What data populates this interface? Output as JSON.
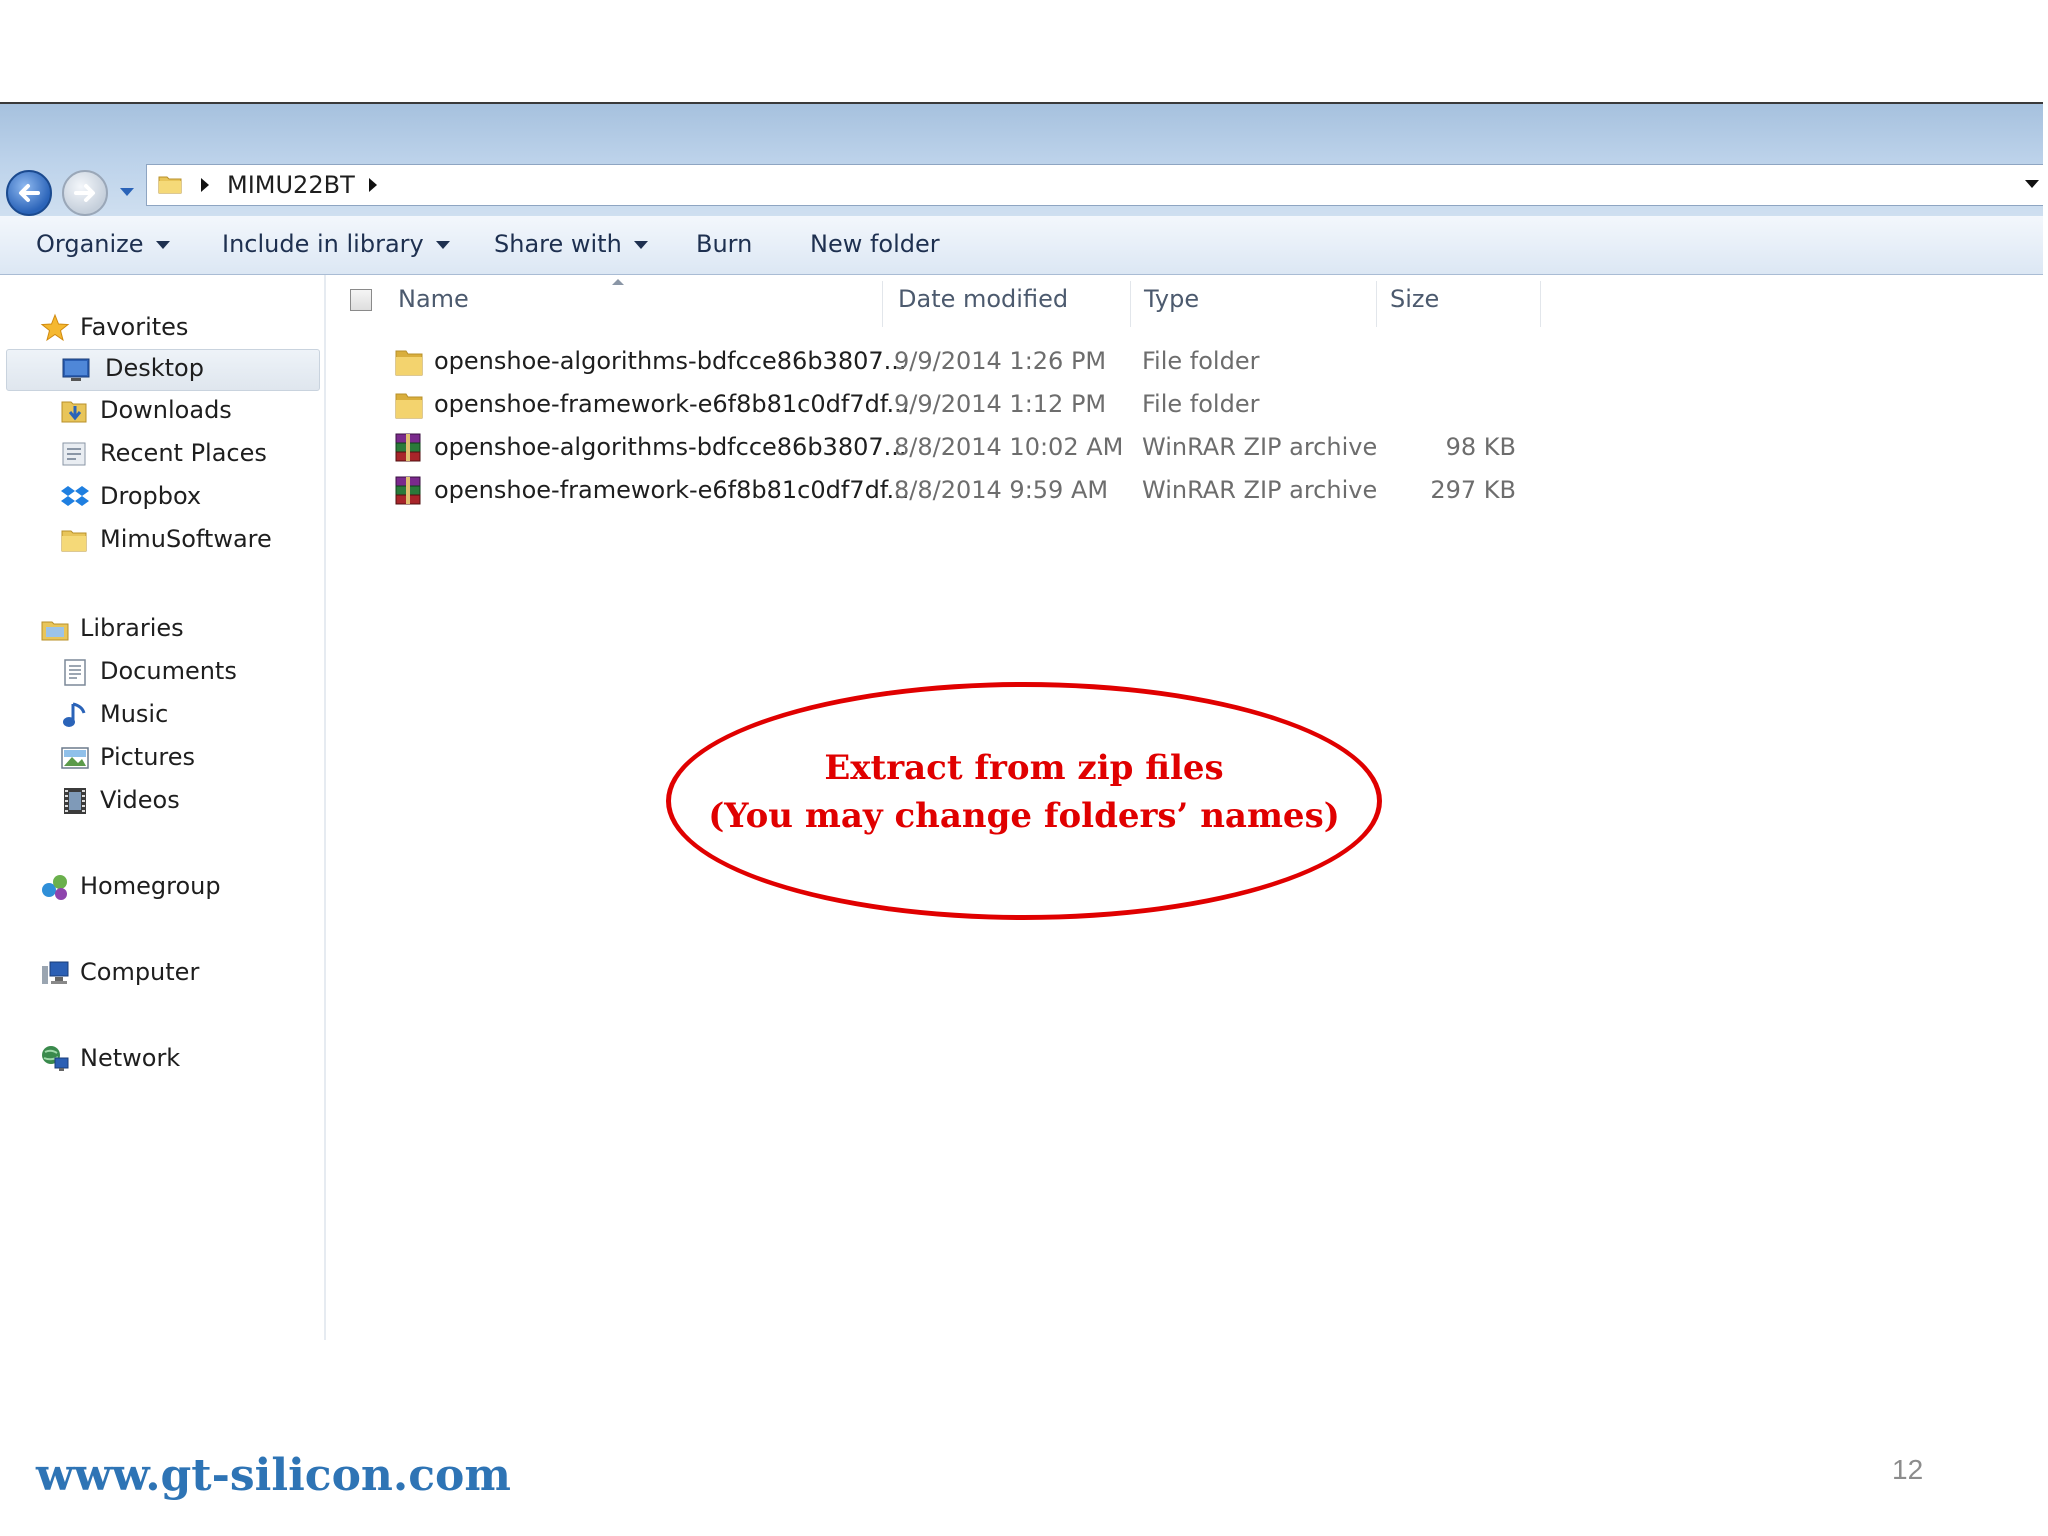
{
  "address_bar": {
    "breadcrumb": "MIMU22BT"
  },
  "toolbar": {
    "organize": "Organize",
    "include_in_library": "Include in library",
    "share_with": "Share with",
    "burn": "Burn",
    "new_folder": "New folder"
  },
  "nav_pane": {
    "favorites": {
      "header": "Favorites",
      "items": [
        "Desktop",
        "Downloads",
        "Recent Places",
        "Dropbox",
        "MimuSoftware"
      ],
      "selected": "Desktop"
    },
    "libraries": {
      "header": "Libraries",
      "items": [
        "Documents",
        "Music",
        "Pictures",
        "Videos"
      ]
    },
    "homegroup": "Homegroup",
    "computer": "Computer",
    "network": "Network"
  },
  "columns": {
    "name": "Name",
    "date_modified": "Date modified",
    "type": "Type",
    "size": "Size"
  },
  "files": [
    {
      "icon": "folder-icon",
      "name": "openshoe-algorithms-bdfcce86b3807...",
      "date": "9/9/2014 1:26 PM",
      "type": "File folder",
      "size": ""
    },
    {
      "icon": "folder-icon",
      "name": "openshoe-framework-e6f8b81c0df7df...",
      "date": "9/9/2014 1:12 PM",
      "type": "File folder",
      "size": ""
    },
    {
      "icon": "winrar-archive-icon",
      "name": "openshoe-algorithms-bdfcce86b3807...",
      "date": "8/8/2014 10:02 AM",
      "type": "WinRAR ZIP archive",
      "size": "98 KB"
    },
    {
      "icon": "winrar-archive-icon",
      "name": "openshoe-framework-e6f8b81c0df7df...",
      "date": "8/8/2014 9:59 AM",
      "type": "WinRAR ZIP archive",
      "size": "297 KB"
    }
  ],
  "callout": {
    "line1": "Extract from zip files",
    "line2": "(You may change folders’ names)",
    "color": "#e00000"
  },
  "slide": {
    "url": "www.gt-silicon.com",
    "page_number": "12"
  }
}
